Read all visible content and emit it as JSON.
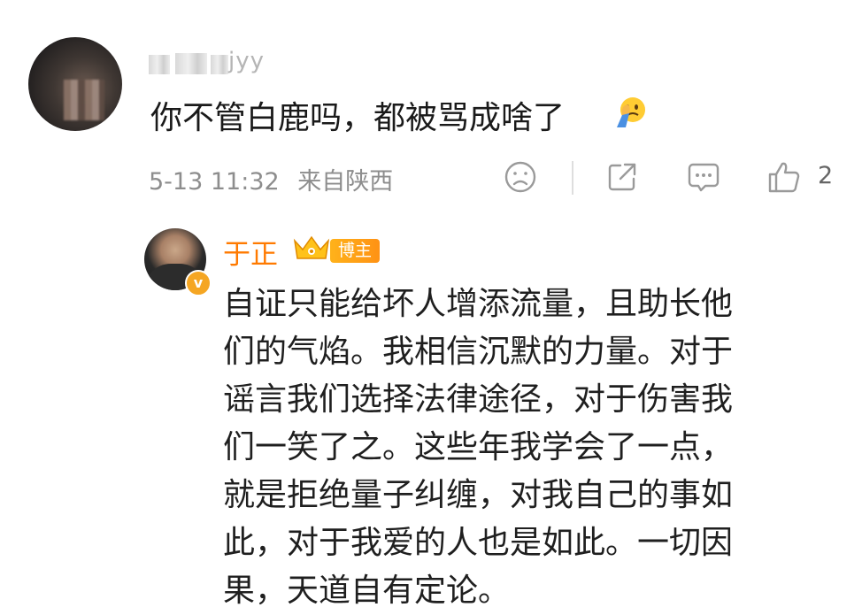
{
  "comment": {
    "username_visible": "jyy",
    "text": "你不管白鹿吗，都被骂成啥了",
    "emoji": "facepalm-emoji",
    "time": "5-13 11:32",
    "location": "来自陕西",
    "like_count": "2"
  },
  "reply": {
    "author": "于正",
    "tag": "博主",
    "verified_badge": "v",
    "lines": [
      "自证只能给坏人增添流量，且助长他",
      "们的气焰。我相信沉默的力量。对于",
      "谣言我们选择法律途径，对于伤害我",
      "们一笑了之。这些年我学会了一点，",
      "就是拒绝量子纠缠，对我自己的事如",
      "此，对于我爱的人也是如此。一切因",
      "果，天道自有定论。"
    ]
  },
  "colors": {
    "accent_orange": "#ff7a00",
    "meta_gray": "#8d8d8d",
    "tag_gradient_start": "#ffb21a",
    "icon_gray": "#9a9a9a"
  },
  "icons": [
    "sad-face-icon",
    "share-icon",
    "comment-icon",
    "thumbs-up-icon"
  ]
}
